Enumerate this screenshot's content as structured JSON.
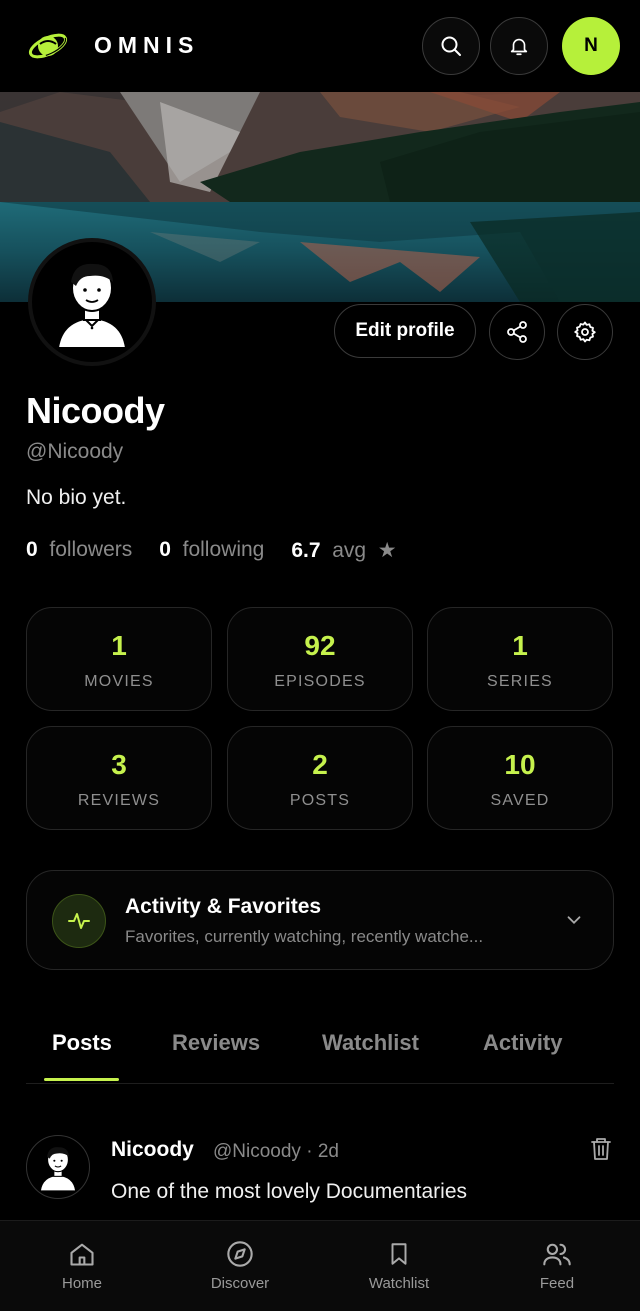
{
  "header": {
    "brand": "OMNIS",
    "avatar_initial": "N",
    "icons": [
      "logo-planet-icon",
      "search-icon",
      "bell-icon"
    ]
  },
  "profile": {
    "name": "Nicoody",
    "handle": "@Nicoody",
    "bio": "No bio yet.",
    "edit_label": "Edit profile",
    "followers_count": "0",
    "followers_label": "followers",
    "following_count": "0",
    "following_label": "following",
    "avg_value": "6.7",
    "avg_label": "avg",
    "star": "★"
  },
  "stats": [
    {
      "value": "1",
      "label": "MOVIES"
    },
    {
      "value": "92",
      "label": "EPISODES"
    },
    {
      "value": "1",
      "label": "SERIES"
    },
    {
      "value": "3",
      "label": "REVIEWS"
    },
    {
      "value": "2",
      "label": "POSTS"
    },
    {
      "value": "10",
      "label": "SAVED"
    }
  ],
  "activity": {
    "title": "Activity & Favorites",
    "subtitle": "Favorites, currently watching, recently watche..."
  },
  "tabs": [
    {
      "label": "Posts",
      "active": true
    },
    {
      "label": "Reviews",
      "active": false
    },
    {
      "label": "Watchlist",
      "active": false
    },
    {
      "label": "Activity",
      "active": false
    }
  ],
  "post": {
    "author": "Nicoody",
    "meta": "@Nicoody · 2d",
    "text": "One of the most lovely Documentaries"
  },
  "nav": [
    {
      "label": "Home",
      "icon": "home-icon"
    },
    {
      "label": "Discover",
      "icon": "compass-icon"
    },
    {
      "label": "Watchlist",
      "icon": "bookmark-icon"
    },
    {
      "label": "Feed",
      "icon": "users-icon"
    }
  ],
  "colors": {
    "accent": "#c6f24d",
    "avatar_bg": "#b6f03a",
    "background": "#000000"
  }
}
